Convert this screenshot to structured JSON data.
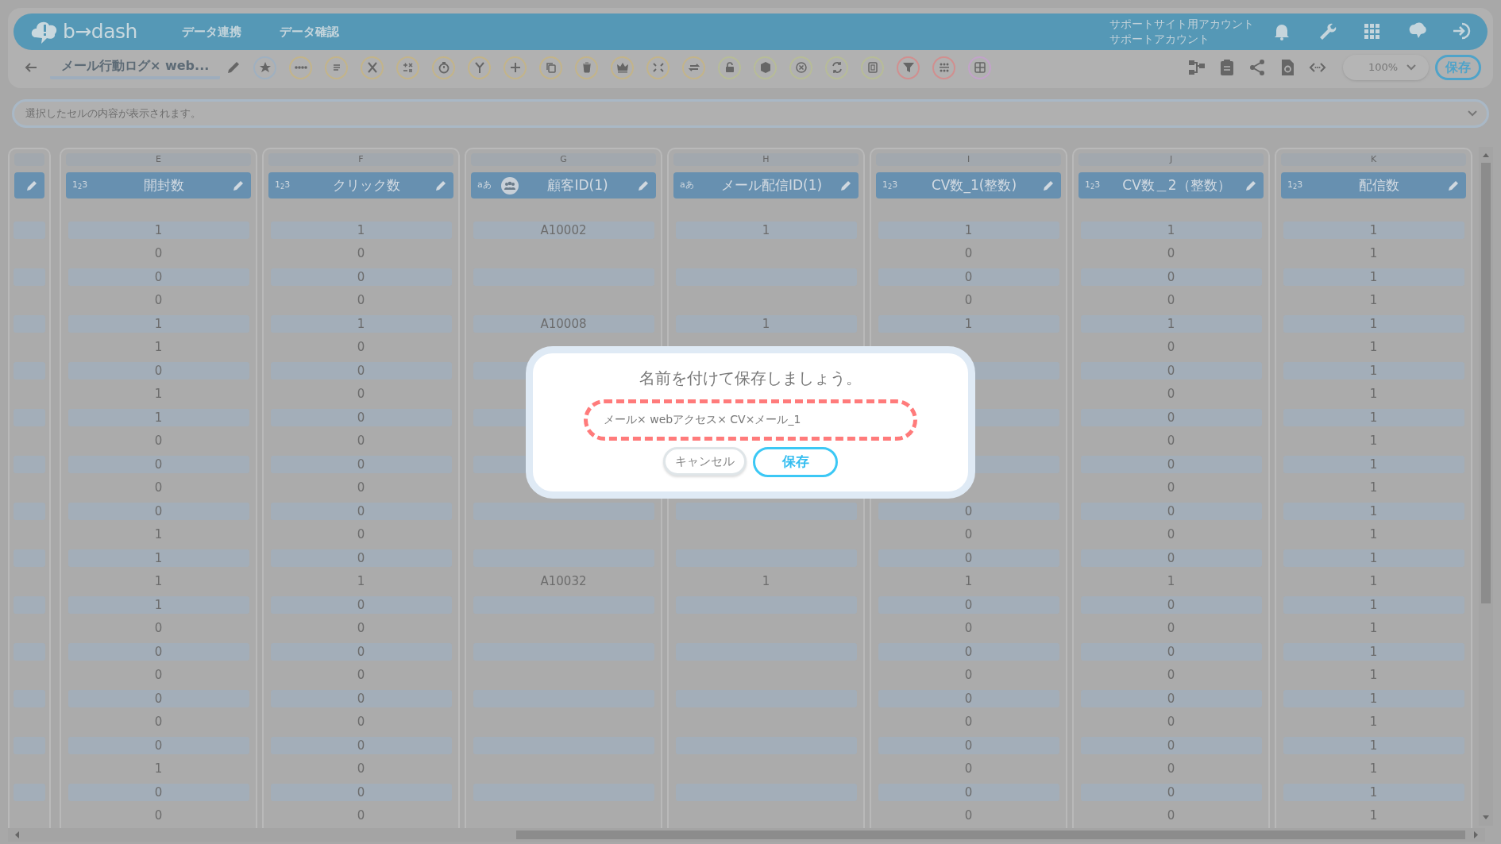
{
  "app": {
    "logo": "b→dash",
    "nav": [
      {
        "label": "データ連携"
      },
      {
        "label": "データ確認"
      }
    ],
    "account": {
      "line_1": "サポートサイト用アカウント",
      "line_2": "サポートアカウント"
    }
  },
  "toolbar": {
    "title": "メール行動ログ× web...",
    "zoom": "100%",
    "save_button": "保存"
  },
  "cell_viewer": {
    "placeholder": "選択したセルの内容が表示されます。"
  },
  "columns": [
    {
      "letter": "E",
      "name": "開封数",
      "type_mark": "1$_{2}$3",
      "grouped": false
    },
    {
      "letter": "F",
      "name": "クリック数",
      "type_mark": "1$_{2}$3",
      "grouped": false
    },
    {
      "letter": "G",
      "name": "顧客ID(1)",
      "type_mark": "aあ",
      "grouped": true
    },
    {
      "letter": "H",
      "name": "メール配信ID(1)",
      "type_mark": "aあ",
      "grouped": false
    },
    {
      "letter": "I",
      "name": "CV数_1(整数)",
      "type_mark": "1$_{2}$3",
      "grouped": false
    },
    {
      "letter": "J",
      "name": "CV数＿2（整数）",
      "type_mark": "1$_{2}$3",
      "grouped": false
    },
    {
      "letter": "K",
      "name": "配信数",
      "type_mark": "1$_{2}$3",
      "grouped": false
    }
  ],
  "rows": [
    [
      "1",
      "1",
      "A10002",
      "1",
      "1",
      "1",
      "1"
    ],
    [
      "0",
      "0",
      null,
      null,
      "0",
      "0",
      "1"
    ],
    [
      "0",
      "0",
      null,
      null,
      "0",
      "0",
      "1"
    ],
    [
      "0",
      "0",
      null,
      null,
      "0",
      "0",
      "1"
    ],
    [
      "1",
      "1",
      "A10008",
      "1",
      "1",
      "1",
      "1"
    ],
    [
      "1",
      "0",
      null,
      null,
      null,
      "0",
      "1"
    ],
    [
      "0",
      "0",
      null,
      null,
      null,
      "0",
      "1"
    ],
    [
      "1",
      "0",
      null,
      null,
      null,
      "0",
      "1"
    ],
    [
      "1",
      "0",
      null,
      null,
      null,
      "0",
      "1"
    ],
    [
      "0",
      "0",
      null,
      null,
      null,
      "0",
      "1"
    ],
    [
      "0",
      "0",
      null,
      null,
      null,
      "0",
      "1"
    ],
    [
      "0",
      "0",
      null,
      null,
      null,
      "0",
      "1"
    ],
    [
      "0",
      "0",
      null,
      null,
      "0",
      "0",
      "1"
    ],
    [
      "1",
      "0",
      null,
      null,
      "0",
      "0",
      "1"
    ],
    [
      "1",
      "0",
      null,
      null,
      "0",
      "0",
      "1"
    ],
    [
      "1",
      "1",
      "A10032",
      "1",
      "1",
      "1",
      "1"
    ],
    [
      "1",
      "0",
      null,
      null,
      "0",
      "0",
      "1"
    ],
    [
      "0",
      "0",
      null,
      null,
      "0",
      "0",
      "1"
    ],
    [
      "0",
      "0",
      null,
      null,
      "0",
      "0",
      "1"
    ],
    [
      "0",
      "0",
      null,
      null,
      "0",
      "0",
      "1"
    ],
    [
      "0",
      "0",
      null,
      null,
      "0",
      "0",
      "1"
    ],
    [
      "0",
      "0",
      null,
      null,
      "0",
      "0",
      "1"
    ],
    [
      "0",
      "0",
      null,
      null,
      "0",
      "0",
      "1"
    ],
    [
      "1",
      "0",
      null,
      null,
      "0",
      "0",
      "1"
    ],
    [
      "0",
      "0",
      null,
      null,
      "0",
      "0",
      "1"
    ],
    [
      "0",
      "0",
      null,
      null,
      "0",
      "0",
      "1"
    ]
  ],
  "dialog": {
    "title": "名前を付けて保存しましょう。",
    "value": "メール× webアクセス× CV×メール_1",
    "cancel_button": "キャンセル",
    "save_button": "保存"
  }
}
